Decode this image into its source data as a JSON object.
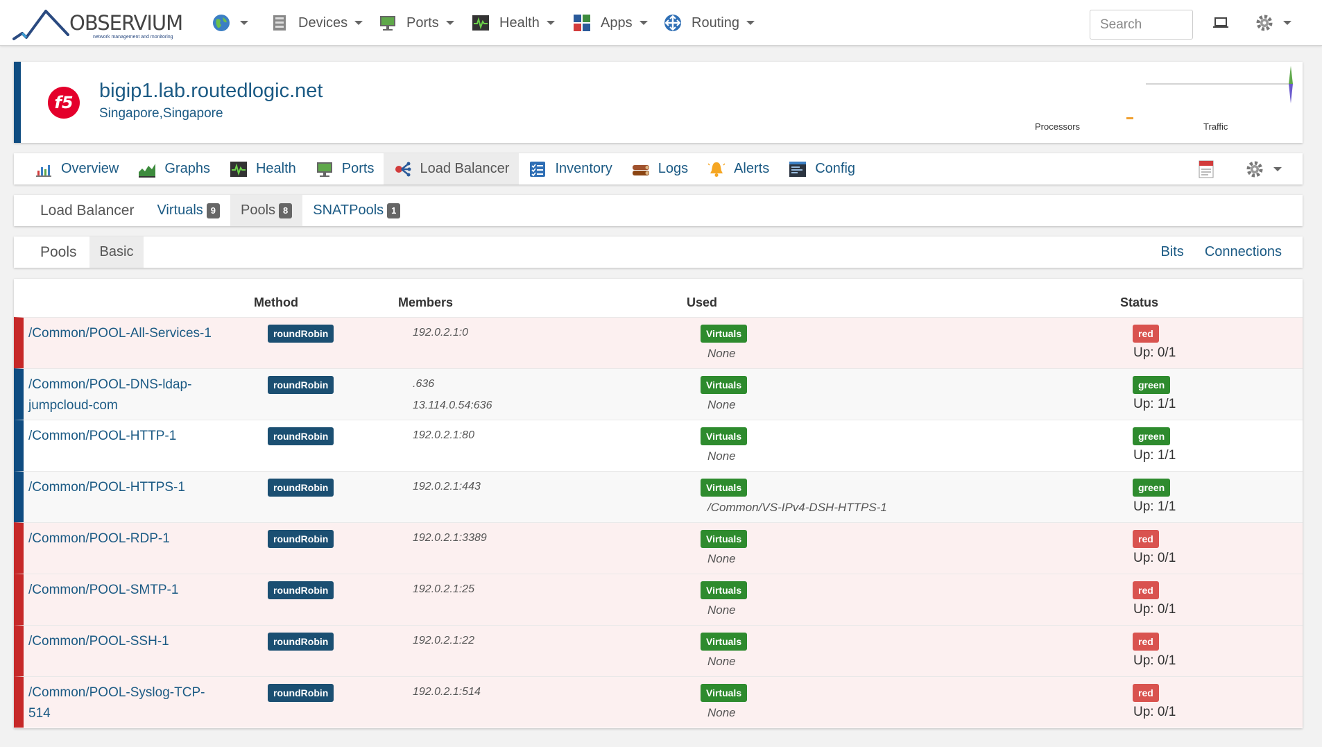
{
  "brand": {
    "name": "OBSERVIUM",
    "tagline": "network management and monitoring"
  },
  "navbar": {
    "items": [
      {
        "label": "",
        "icon": "globe-icon"
      },
      {
        "label": "Devices",
        "icon": "server-icon"
      },
      {
        "label": "Ports",
        "icon": "network-port-icon"
      },
      {
        "label": "Health",
        "icon": "heartbeat-icon"
      },
      {
        "label": "Apps",
        "icon": "apps-grid-icon"
      },
      {
        "label": "Routing",
        "icon": "routing-icon"
      }
    ],
    "search_placeholder": "Search"
  },
  "device": {
    "hostname": "bigip1.lab.routedlogic.net",
    "location": "Singapore,Singapore",
    "graph_labels": {
      "processors": "Processors",
      "traffic": "Traffic"
    }
  },
  "device_tabs": [
    {
      "label": "Overview",
      "icon": "overview-icon"
    },
    {
      "label": "Graphs",
      "icon": "graphs-icon"
    },
    {
      "label": "Health",
      "icon": "heartbeat-icon"
    },
    {
      "label": "Ports",
      "icon": "network-port-icon"
    },
    {
      "label": "Load Balancer",
      "icon": "load-balancer-icon",
      "active": true
    },
    {
      "label": "Inventory",
      "icon": "inventory-icon"
    },
    {
      "label": "Logs",
      "icon": "logs-icon"
    },
    {
      "label": "Alerts",
      "icon": "bell-icon"
    },
    {
      "label": "Config",
      "icon": "config-icon"
    }
  ],
  "lb_tabs": {
    "title": "Load Balancer",
    "items": [
      {
        "label": "Virtuals",
        "count": "9"
      },
      {
        "label": "Pools",
        "count": "8",
        "active": true
      },
      {
        "label": "SNATPools",
        "count": "1"
      }
    ]
  },
  "view_tabs": {
    "title": "Pools",
    "left": [
      {
        "label": "Basic",
        "active": true
      }
    ],
    "right": [
      {
        "label": "Bits"
      },
      {
        "label": "Connections"
      }
    ]
  },
  "table": {
    "headers": {
      "method": "Method",
      "members": "Members",
      "used": "Used",
      "status": "Status"
    },
    "used_label": "Virtuals",
    "rows": [
      {
        "name": "/Common/POOL-All-Services-1",
        "method": "roundRobin",
        "members": [
          "192.0.2.1:0"
        ],
        "used": "None",
        "status": "red",
        "up": "Up: 0/1"
      },
      {
        "name": "/Common/POOL-DNS-ldap-jumpcloud-com",
        "method": "roundRobin",
        "members": [
          ".636",
          "13.114.0.54:636"
        ],
        "used": "None",
        "status": "green",
        "up": "Up: 1/1"
      },
      {
        "name": "/Common/POOL-HTTP-1",
        "method": "roundRobin",
        "members": [
          "192.0.2.1:80"
        ],
        "used": "None",
        "status": "green",
        "up": "Up: 1/1"
      },
      {
        "name": "/Common/POOL-HTTPS-1",
        "method": "roundRobin",
        "members": [
          "192.0.2.1:443"
        ],
        "used": "/Common/VS-IPv4-DSH-HTTPS-1",
        "status": "green",
        "up": "Up: 1/1"
      },
      {
        "name": "/Common/POOL-RDP-1",
        "method": "roundRobin",
        "members": [
          "192.0.2.1:3389"
        ],
        "used": "None",
        "status": "red",
        "up": "Up: 0/1"
      },
      {
        "name": "/Common/POOL-SMTP-1",
        "method": "roundRobin",
        "members": [
          "192.0.2.1:25"
        ],
        "used": "None",
        "status": "red",
        "up": "Up: 0/1"
      },
      {
        "name": "/Common/POOL-SSH-1",
        "method": "roundRobin",
        "members": [
          "192.0.2.1:22"
        ],
        "used": "None",
        "status": "red",
        "up": "Up: 0/1"
      },
      {
        "name": "/Common/POOL-Syslog-TCP-514",
        "method": "roundRobin",
        "members": [
          "192.0.2.1:514"
        ],
        "used": "None",
        "status": "red",
        "up": "Up: 0/1"
      }
    ]
  },
  "colors": {
    "brand_blue": "#0f4c81",
    "status_red": "#d9534f",
    "status_green": "#2e8b2e",
    "link": "#1b5a84"
  }
}
